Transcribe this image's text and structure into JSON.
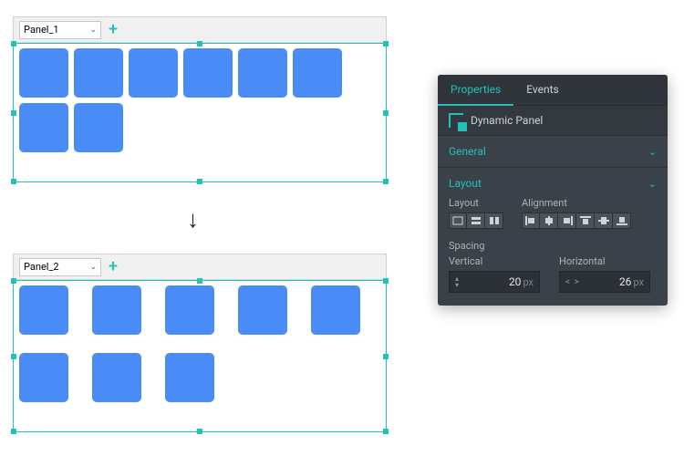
{
  "panel1": {
    "label": "Panel_1",
    "tile_size": 54,
    "gap": 6,
    "tiles": 8,
    "cols": 6
  },
  "panel2": {
    "label": "Panel_2",
    "tile_size": 54,
    "gap_h": 26,
    "gap_v": 20,
    "tiles": 8,
    "cols": 5
  },
  "inspector": {
    "tabs": {
      "properties": "Properties",
      "events": "Events"
    },
    "object_name": "Dynamic Panel",
    "sections": {
      "general": "General",
      "layout": "Layout"
    },
    "layout_label": "Layout",
    "alignment_label": "Alignment",
    "spacing_label": "Spacing",
    "vertical_label": "Vertical",
    "horizontal_label": "Horizontal",
    "vertical_value": "20",
    "horizontal_value": "26",
    "unit": "px"
  }
}
